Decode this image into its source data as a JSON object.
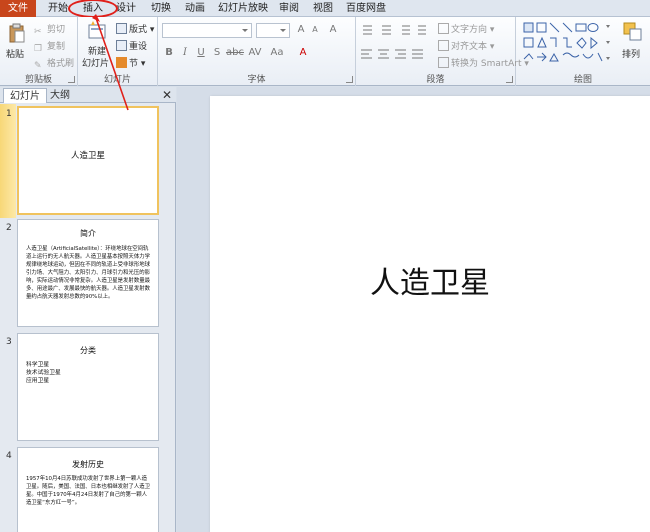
{
  "tabs": [
    "文件",
    "开始",
    "插入",
    "设计",
    "切换",
    "动画",
    "幻灯片放映",
    "审阅",
    "视图",
    "百度网盘"
  ],
  "clipboard": {
    "paste": "粘贴",
    "cut": "剪切",
    "copy": "复制",
    "format_painter": "格式刷",
    "group": "剪贴板"
  },
  "slides_group": {
    "new_slide_line1": "新建",
    "new_slide_line2": "幻灯片",
    "layout": "版式",
    "reset": "重设",
    "section": "节",
    "group": "幻灯片"
  },
  "font_group": {
    "group": "字体"
  },
  "paragraph_group": {
    "text_direction": "文字方向",
    "align_text": "对齐文本",
    "smartart": "转换为 SmartArt",
    "group": "段落"
  },
  "drawing_group": {
    "arrange": "排列",
    "group": "绘图"
  },
  "panel": {
    "tab_slides": "幻灯片",
    "tab_outline": "大纲",
    "close": "✕"
  },
  "slides": [
    {
      "num": "1",
      "title": "人造卫星",
      "body": ""
    },
    {
      "num": "2",
      "title": "简介",
      "body": "人造卫星（ArtificialSatellite）：环绕地球在空间轨道上运行的无人航天器。人造卫星基本按照天体力学规律绕地球运动，但因在不同的轨道上受非球形地球引力场、大气阻力、太阳引力、月球引力和光压的影响，实际运动情况非常复杂。人造卫星是发射数量最多、用途最广、发展最快的航天器。人造卫星发射数量约占航天器发射总数的90%以上。"
    },
    {
      "num": "3",
      "title": "分类",
      "body": "科学卫星\n技术试验卫星\n应用卫星"
    },
    {
      "num": "4",
      "title": "发射历史",
      "body": "1957年10月4日苏联成功发射了世界上第一颗人造卫星。随后，美国、法国、日本也相继发射了人造卫星。中国于1970年4月24日发射了自己的第一颗人造卫星“东方红一号”。"
    }
  ],
  "main_slide": {
    "title": "人造卫星"
  }
}
